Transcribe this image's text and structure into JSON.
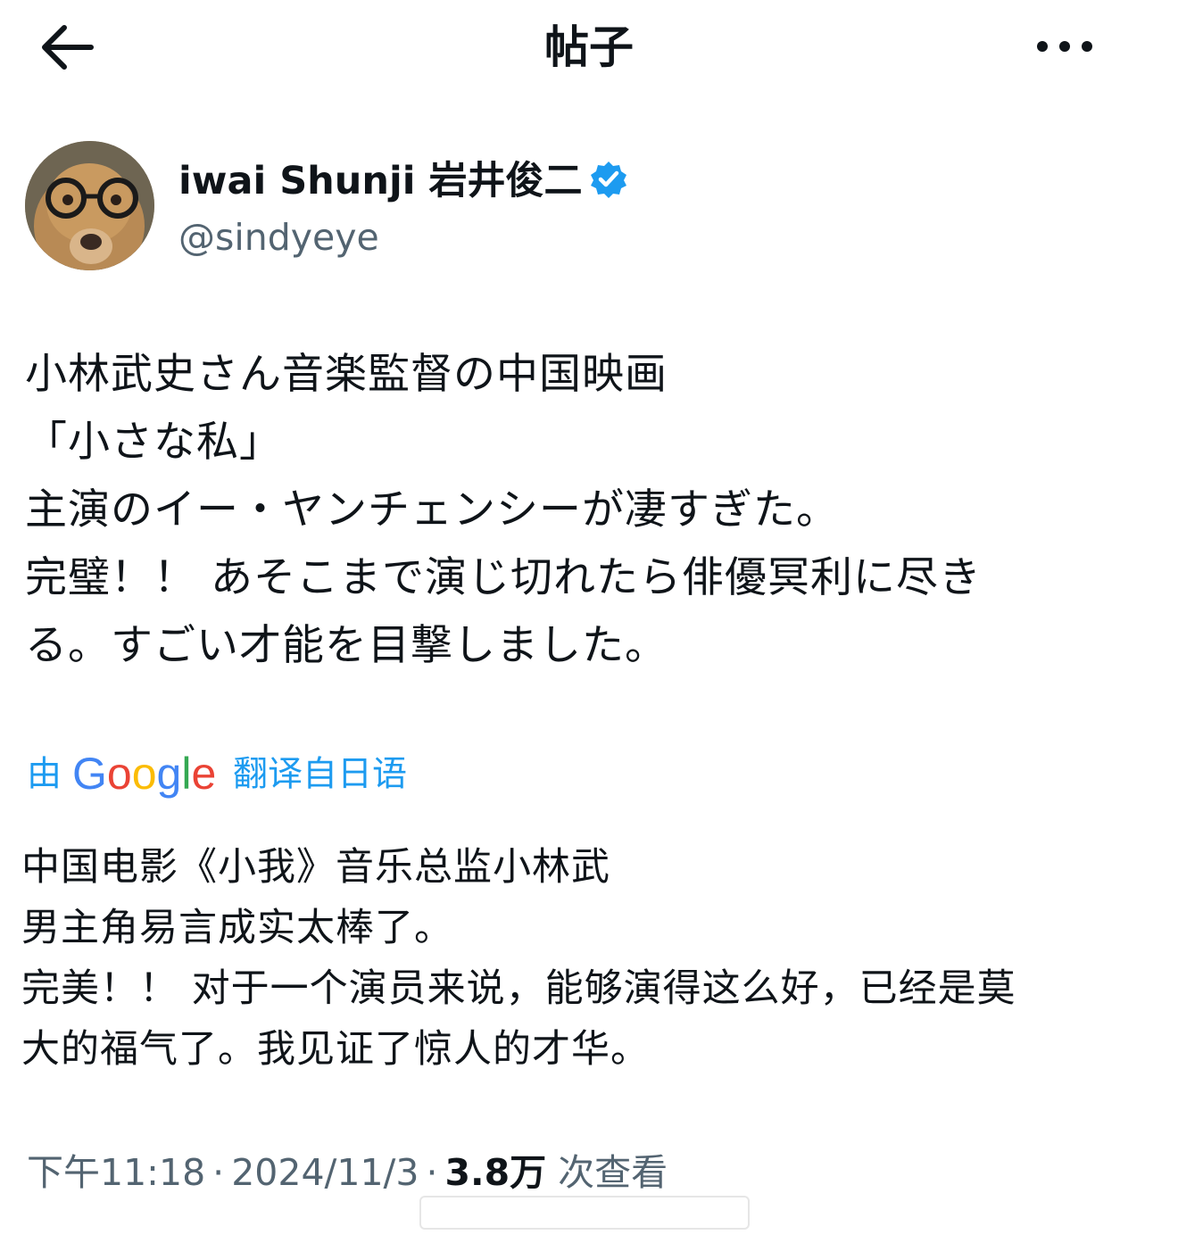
{
  "header": {
    "title": "帖子",
    "back_icon": "arrow-left-icon",
    "more_icon": "more-horizontal-icon"
  },
  "author": {
    "display_name": "iwai Shunji 岩井俊二",
    "handle": "@sindyeye",
    "verified": true,
    "verified_color": "#1d9bf0"
  },
  "post": {
    "lines": [
      "小林武史さん音楽監督の中国映画",
      "「小さな私」",
      "主演のイー・ヤンチェンシーが凄すぎた。",
      "完璧！！ あそこまで演じ切れたら俳優冥利に尽き",
      "る。すごい才能を目撃しました。"
    ]
  },
  "translation_notice": {
    "prefix": "由",
    "provider": "Google",
    "suffix": "翻译自日语",
    "color": "#1d9bf0"
  },
  "translation": {
    "lines": [
      "中国电影《小我》音乐总监小林武",
      "男主角易言成实太棒了。",
      "完美！！ 对于一个演员来说，能够演得这么好，已经是莫",
      "大的福气了。我见证了惊人的才华。"
    ]
  },
  "meta": {
    "time": "下午11:18",
    "separator": "·",
    "date": "2024/11/3",
    "views_count": "3.8万",
    "views_label": "次查看"
  },
  "colors": {
    "text": "#0f1419",
    "secondary": "#536471",
    "accent": "#1d9bf0"
  }
}
